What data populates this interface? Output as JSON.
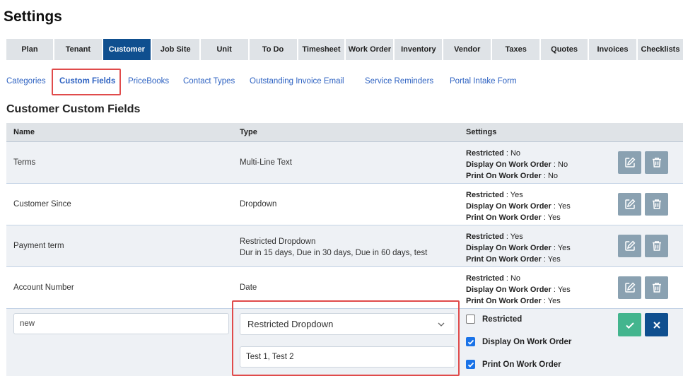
{
  "page_title": "Settings",
  "tabs": [
    {
      "label": "Plan",
      "active": false
    },
    {
      "label": "Tenant",
      "active": false
    },
    {
      "label": "Customer",
      "active": true
    },
    {
      "label": "Job Site",
      "active": false
    },
    {
      "label": "Unit",
      "active": false
    },
    {
      "label": "To Do",
      "active": false
    },
    {
      "label": "Timesheet",
      "active": false
    },
    {
      "label": "Work Order",
      "active": false
    },
    {
      "label": "Inventory",
      "active": false
    },
    {
      "label": "Vendor",
      "active": false
    },
    {
      "label": "Taxes",
      "active": false
    },
    {
      "label": "Quotes",
      "active": false
    },
    {
      "label": "Invoices",
      "active": false
    },
    {
      "label": "Checklists",
      "active": false
    }
  ],
  "subnav": [
    {
      "label": "Categories",
      "active": false
    },
    {
      "label": "Custom Fields",
      "active": true
    },
    {
      "label": "PriceBooks",
      "active": false
    },
    {
      "label": "Contact Types",
      "active": false
    },
    {
      "label": "Outstanding Invoice Email",
      "active": false
    },
    {
      "label": "Service Reminders",
      "active": false
    },
    {
      "label": "Portal Intake Form",
      "active": false
    }
  ],
  "section_title": "Customer Custom Fields",
  "columns": {
    "name": "Name",
    "type": "Type",
    "settings": "Settings"
  },
  "setting_labels": {
    "restricted": "Restricted",
    "display": "Display On Work Order",
    "print": "Print On Work Order",
    "sep": " : "
  },
  "rows": [
    {
      "name": "Terms",
      "type": "Multi-Line Text",
      "type_detail": "",
      "restricted": "No",
      "display": "No",
      "print": "No"
    },
    {
      "name": "Customer Since",
      "type": "Dropdown",
      "type_detail": "",
      "restricted": "Yes",
      "display": "Yes",
      "print": "Yes"
    },
    {
      "name": "Payment term",
      "type": "Restricted Dropdown",
      "type_detail": "Dur in 15 days, Due in 30 days, Due in 60 days, test",
      "restricted": "Yes",
      "display": "Yes",
      "print": "Yes"
    },
    {
      "name": "Account Number",
      "type": "Date",
      "type_detail": "",
      "restricted": "No",
      "display": "Yes",
      "print": "Yes"
    }
  ],
  "new_row": {
    "name_value": "new",
    "type_selected": "Restricted Dropdown",
    "options_value": "Test 1, Test 2",
    "restricted_checked": false,
    "display_checked": true,
    "print_checked": true
  },
  "colors": {
    "active_tab": "#0f4f8f",
    "link": "#2f63c2",
    "highlight": "#e04b4b",
    "save": "#43b58e",
    "cancel": "#0f4f8f",
    "action_gray": "#8aa1b1"
  }
}
